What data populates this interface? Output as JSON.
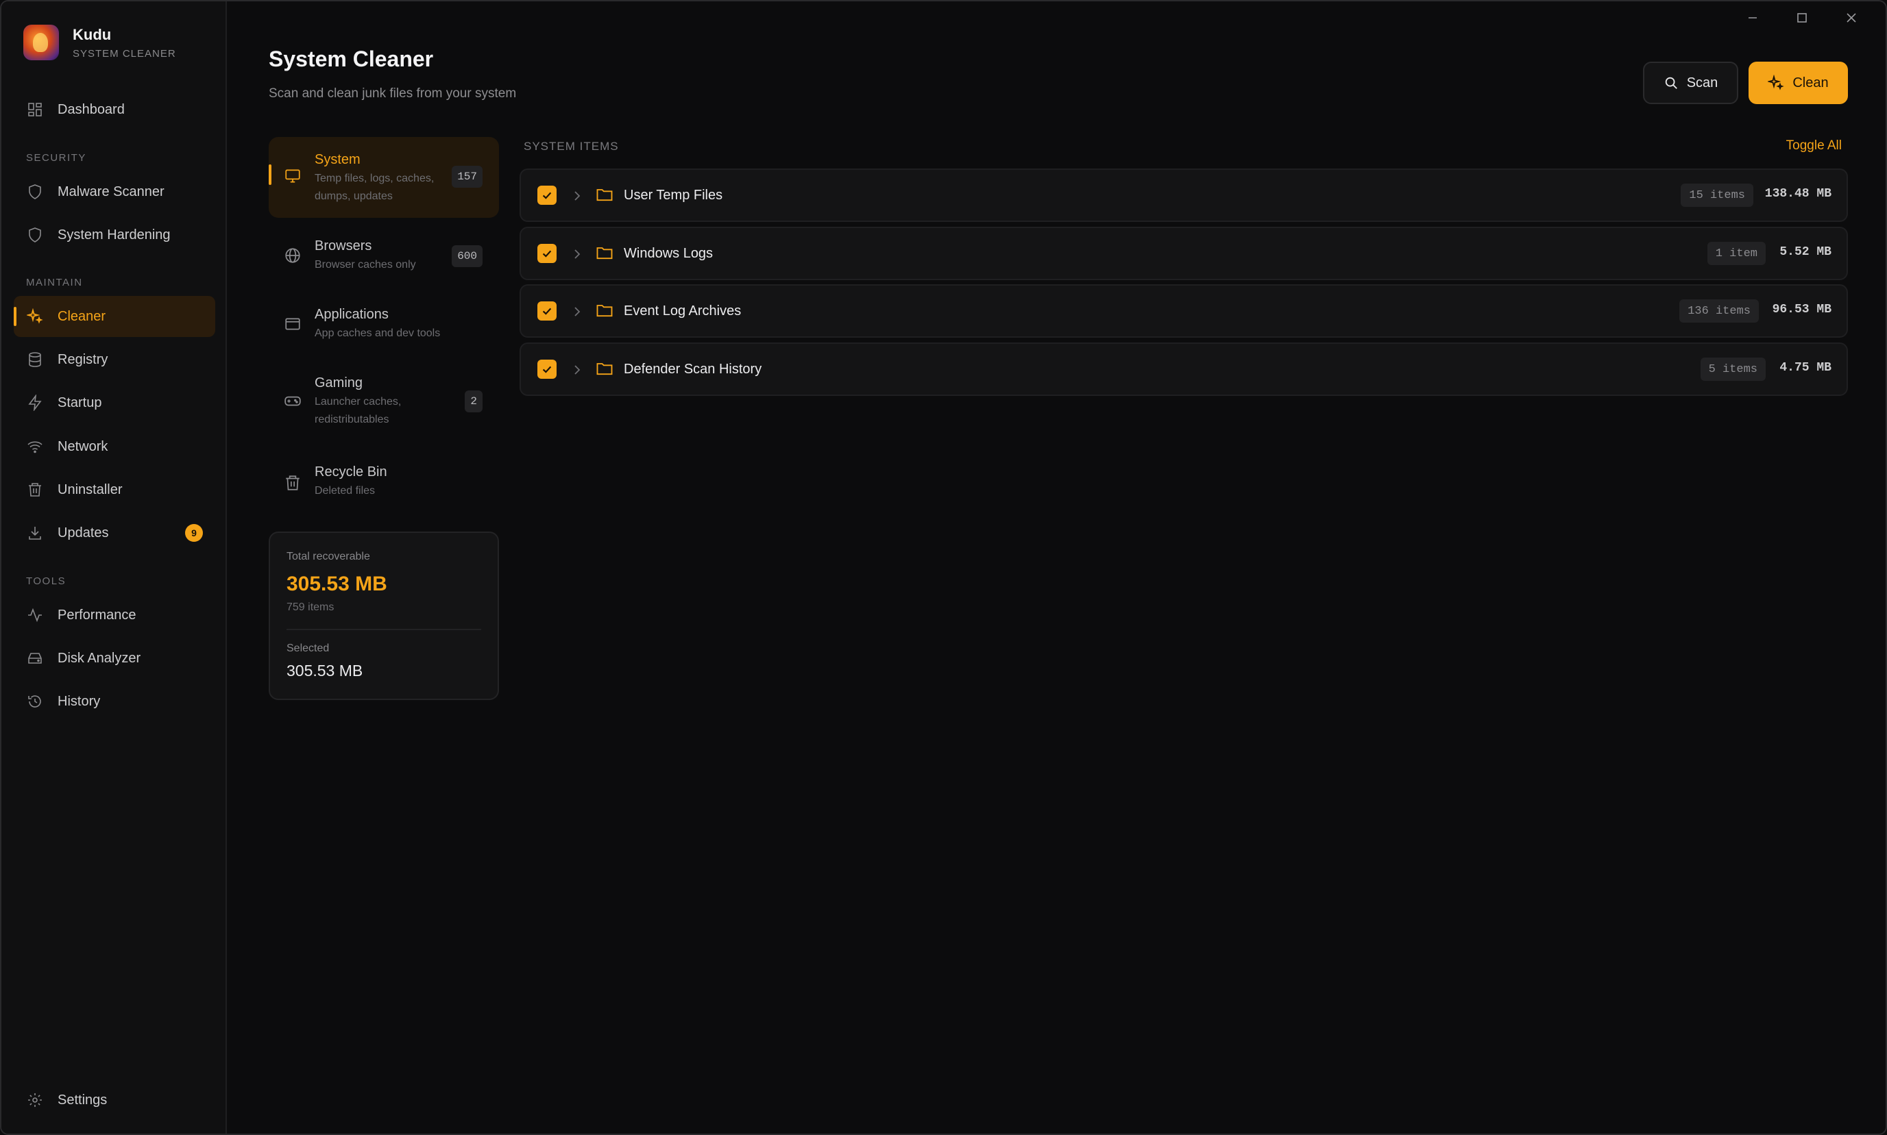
{
  "app": {
    "name": "Kudu",
    "subtitle": "SYSTEM CLEANER"
  },
  "window_controls": [
    "minimize",
    "maximize",
    "close"
  ],
  "sidebar": {
    "sections": {
      "security": "SECURITY",
      "maintain": "MAINTAIN",
      "tools": "TOOLS"
    },
    "items": [
      {
        "label": "Dashboard",
        "icon": "grid-icon"
      },
      {
        "label": "Malware Scanner",
        "icon": "shield-icon"
      },
      {
        "label": "System Hardening",
        "icon": "shield-icon"
      },
      {
        "label": "Cleaner",
        "icon": "sparkle-icon",
        "active": true
      },
      {
        "label": "Registry",
        "icon": "database-icon"
      },
      {
        "label": "Startup",
        "icon": "lightning-icon"
      },
      {
        "label": "Network",
        "icon": "wifi-icon"
      },
      {
        "label": "Uninstaller",
        "icon": "trash-icon"
      },
      {
        "label": "Updates",
        "icon": "download-icon",
        "badge": "9"
      },
      {
        "label": "Performance",
        "icon": "activity-icon"
      },
      {
        "label": "Disk Analyzer",
        "icon": "disk-icon"
      },
      {
        "label": "History",
        "icon": "history-icon"
      },
      {
        "label": "Settings",
        "icon": "gear-icon"
      }
    ]
  },
  "header": {
    "title": "System Cleaner",
    "subtitle": "Scan and clean junk files from your system",
    "scan_label": "Scan",
    "clean_label": "Clean"
  },
  "categories": [
    {
      "title": "System",
      "desc": "Temp files, logs, caches, dumps, updates",
      "count": "157",
      "active": true
    },
    {
      "title": "Browsers",
      "desc": "Browser caches only",
      "count": "600"
    },
    {
      "title": "Applications",
      "desc": "App caches and dev tools",
      "count": ""
    },
    {
      "title": "Gaming",
      "desc": "Launcher caches, redistributables",
      "count": "2"
    },
    {
      "title": "Recycle Bin",
      "desc": "Deleted files",
      "count": ""
    }
  ],
  "summary": {
    "total_label": "Total recoverable",
    "total_value": "305.53 MB",
    "total_items": "759 items",
    "selected_label": "Selected",
    "selected_value": "305.53 MB"
  },
  "items_list": {
    "header": "SYSTEM ITEMS",
    "toggle_all": "Toggle All",
    "rows": [
      {
        "name": "User Temp Files",
        "count": "15 items",
        "size": "138.48 MB",
        "checked": true
      },
      {
        "name": "Windows Logs",
        "count": "1 item",
        "size": "5.52 MB",
        "checked": true
      },
      {
        "name": "Event Log Archives",
        "count": "136 items",
        "size": "96.53 MB",
        "checked": true
      },
      {
        "name": "Defender Scan History",
        "count": "5 items",
        "size": "4.75 MB",
        "checked": true
      }
    ]
  },
  "colors": {
    "accent": "#f5a418",
    "background": "#0c0c0d",
    "panel": "#141415"
  }
}
